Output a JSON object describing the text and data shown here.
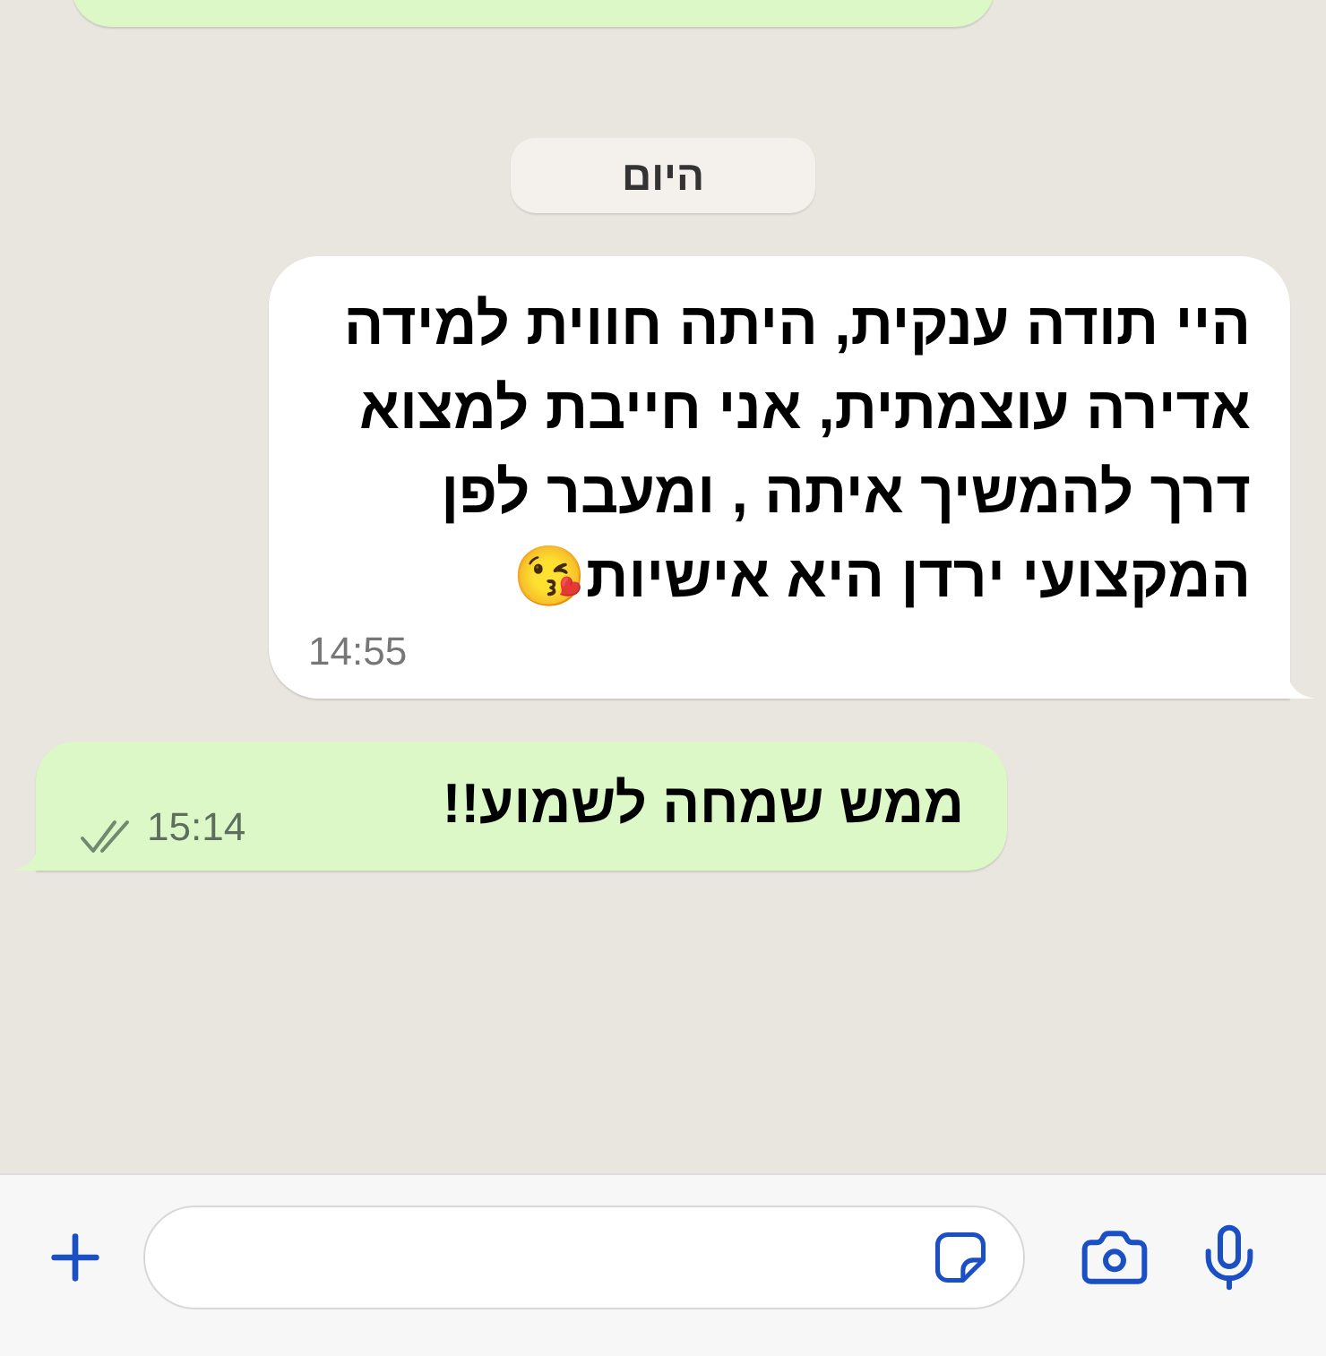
{
  "date_chip": "היום",
  "messages": [
    {
      "kind": "incoming",
      "text": "היי תודה ענקית, היתה חווית למידה אדירה עוצמתית, אני חייבת למצוא דרך להמשיך איתה ,  ומעבר לפן המקצועי ירדן  היא אישיות😘",
      "time": "14:55"
    },
    {
      "kind": "outgoing",
      "text": "ממש שמחה לשמוע!!",
      "time": "15:14",
      "read": true
    }
  ]
}
